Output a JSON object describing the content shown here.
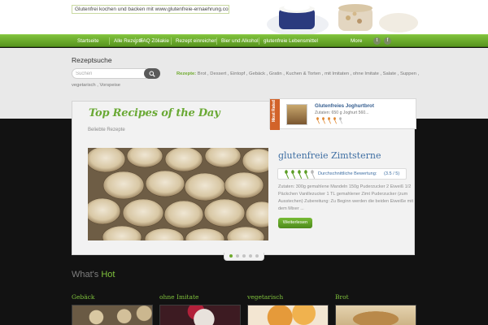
{
  "header": {
    "tagline": "Glutenfrei kochen und backen mit www.glutenfreie-ernaehrung.com"
  },
  "nav": {
    "items": [
      "Startseite",
      "Alle Rezepte",
      "FAQ Zöliakie",
      "Rezept einreichen",
      "Bier und Alkohol",
      "glutenfreie Lebensmittel"
    ],
    "more": "More",
    "social": [
      "t",
      "f"
    ]
  },
  "search": {
    "title": "Rezeptsuche",
    "placeholder": "Suchen",
    "recipes_label": "Rezepte:",
    "categories": [
      "Brot",
      "Dessert",
      "Eintopf",
      "Gebäck",
      "Gratin",
      "Kuchen & Torten",
      "mit Imitaten",
      "ohne Imitate",
      "Salate",
      "Suppen"
    ],
    "categories_line2": [
      "vegetarisch",
      "Vorspeise"
    ]
  },
  "top": {
    "title": "Top Recipes of the Day",
    "subtitle": "Beliebte Rezepte",
    "most_rated": {
      "badge": "Most Rated",
      "name": "Glutenfreies Joghurtbrot",
      "desc": "Zutaten: 650 g Joghurt 560...",
      "spoons": 4
    },
    "featured": {
      "title": "glutenfreie Zimtsterne",
      "rating_label": "Durchschnittliche Bewertung:",
      "rating_value": "(3.5 / 5)",
      "rating": 3.5,
      "description": "Zutaten: 300g gemahlene Mandeln 150g Puderzucker 2 Eiweiß 1/2 Päckchen Vanillezucker 1 TL gemahlener Zimt Puderzucker (zum Ausstechen) Zubereitung: Zu Beginn werden die beiden Eiweiße mit dem Mixer ...",
      "button": "Weiterlesen"
    },
    "pager": {
      "count": 5,
      "active": 1
    }
  },
  "hot": {
    "title_a": "What's",
    "title_b": "Hot",
    "categories": [
      "Gebäck",
      "ohne Imitate",
      "vegetarisch",
      "Brot"
    ]
  },
  "colors": {
    "green": "#7fc13c",
    "nav_dark": "#58951f",
    "link_blue": "#3f6fa3",
    "ribbon": "#d2632a",
    "dark_bg": "#121212"
  }
}
